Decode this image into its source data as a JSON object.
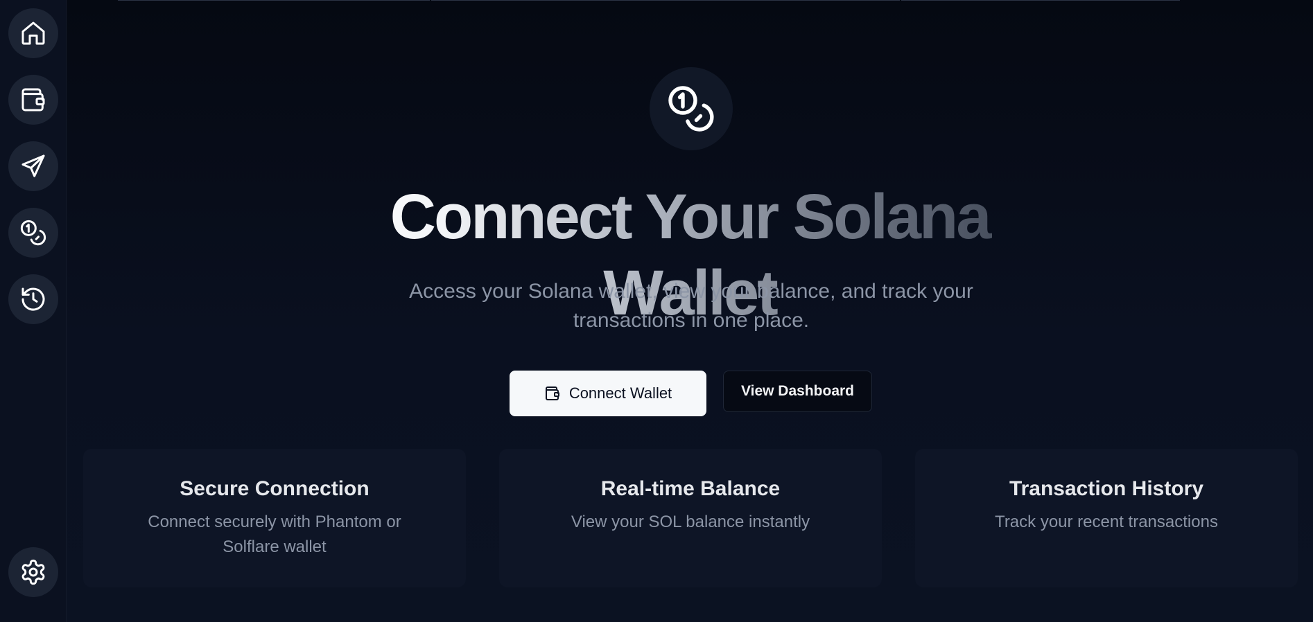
{
  "sidebar": {
    "items": [
      {
        "name": "home",
        "icon": "home-icon"
      },
      {
        "name": "wallet",
        "icon": "wallet-icon"
      },
      {
        "name": "send",
        "icon": "send-icon"
      },
      {
        "name": "coins",
        "icon": "coins-icon"
      },
      {
        "name": "history",
        "icon": "history-icon"
      }
    ],
    "settings_icon": "gear-icon"
  },
  "hero": {
    "icon": "coins-icon",
    "title": "Connect Your Solana Wallet",
    "subtitle": "Access your Solana wallet, view your balance, and track your transactions in one place."
  },
  "actions": {
    "connect_label": "Connect Wallet",
    "dashboard_label": "View Dashboard"
  },
  "features": [
    {
      "title": "Secure Connection",
      "description": "Connect securely with Phantom or Solflare wallet"
    },
    {
      "title": "Real-time Balance",
      "description": "View your SOL balance instantly"
    },
    {
      "title": "Transaction History",
      "description": "Track your recent transactions"
    }
  ],
  "colors": {
    "background": "#080d1a",
    "sidebar": "#0b1120",
    "nav_button": "#1c2434",
    "card": "#0e1526",
    "primary_button": "#f6f8fa",
    "muted_text": "#8c95a6"
  }
}
